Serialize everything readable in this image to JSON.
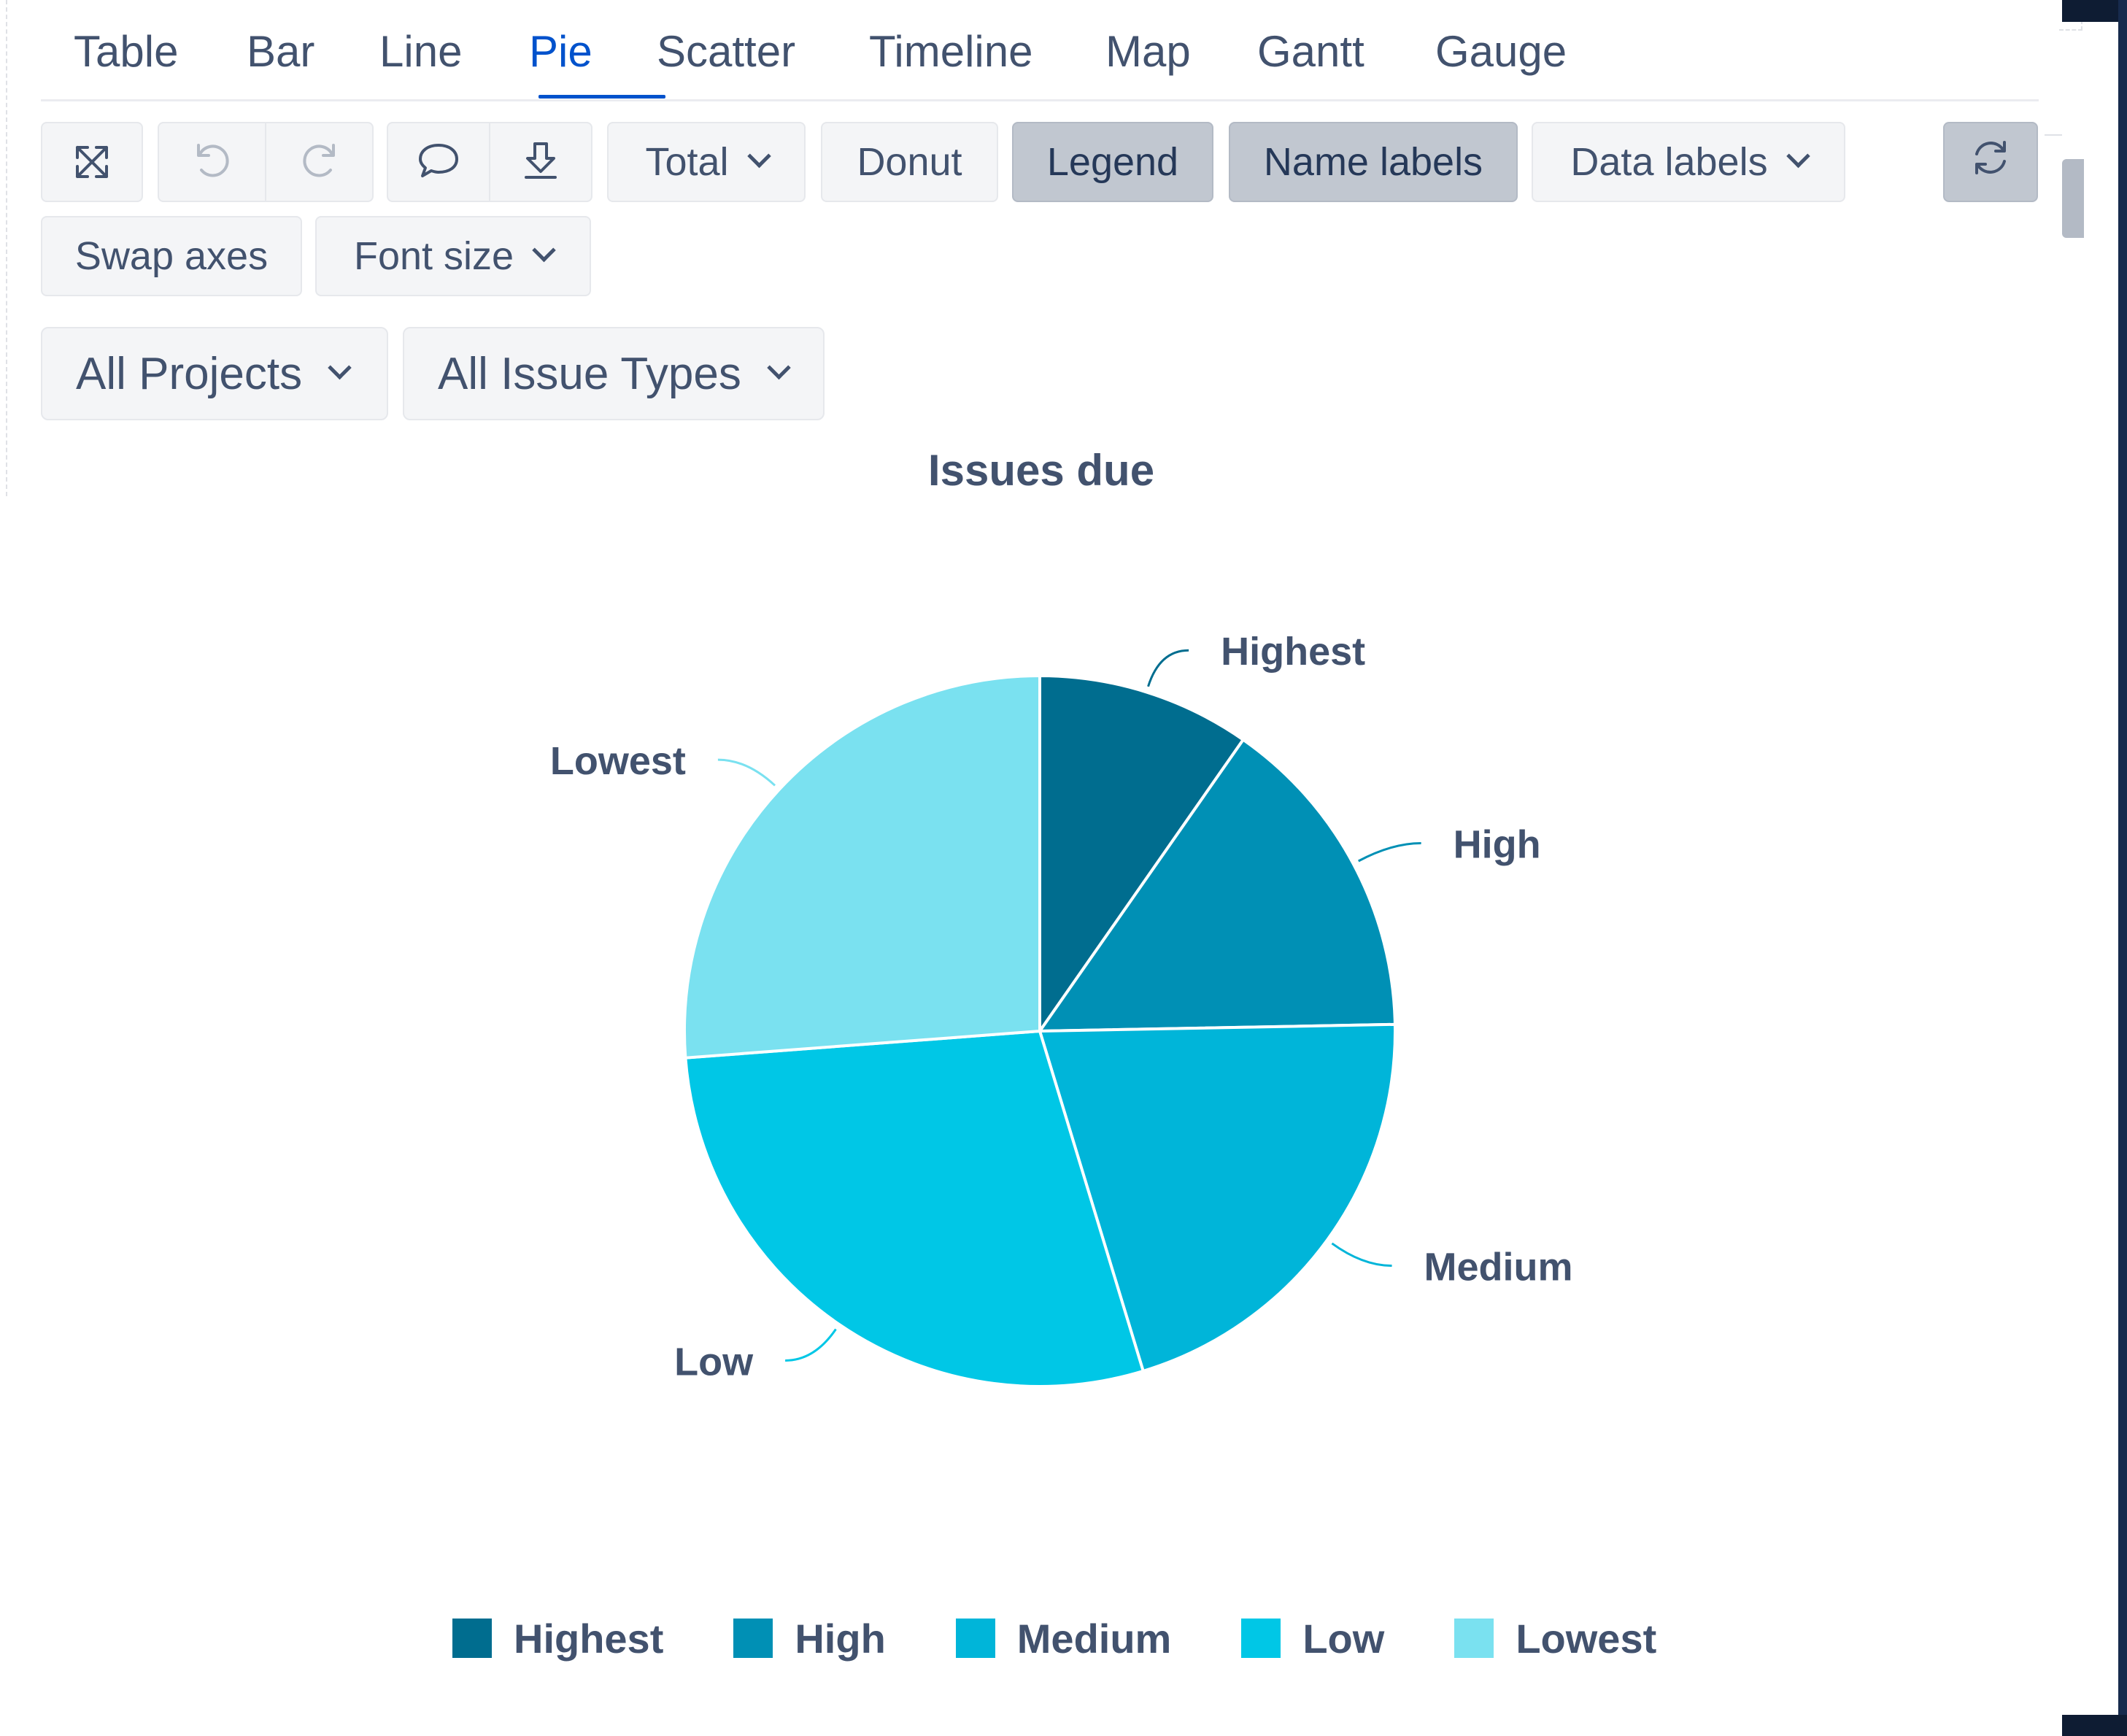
{
  "tabs": [
    "Table",
    "Bar",
    "Line",
    "Pie",
    "Scatter",
    "Timeline",
    "Map",
    "Gantt",
    "Gauge"
  ],
  "active_tab": "Pie",
  "toolbar": {
    "fullscreen_icon": "expand-arrows-icon",
    "undo_icon": "undo-icon",
    "redo_icon": "redo-icon",
    "comment_icon": "speech-bubble-icon",
    "download_icon": "download-icon",
    "total_label": "Total",
    "donut_label": "Donut",
    "legend_label": "Legend",
    "name_labels_label": "Name labels",
    "data_labels_label": "Data labels",
    "refresh_icon": "refresh-icon",
    "swap_axes_label": "Swap axes",
    "font_size_label": "Font size",
    "pressed": [
      "Legend",
      "Name labels"
    ]
  },
  "filters": {
    "projects": "All Projects",
    "issue_types": "All Issue Types"
  },
  "colors": {
    "accent": "#0052cc",
    "text": "#42526e",
    "button_bg": "#f4f5f7",
    "button_pressed_bg": "#c1c7d0"
  },
  "chart_data": {
    "type": "pie",
    "title": "Issues due",
    "categories": [
      "Highest",
      "High",
      "Medium",
      "Low",
      "Lowest"
    ],
    "values": [
      9.7,
      15.0,
      20.6,
      28.5,
      26.2
    ],
    "colors": [
      "#006d8f",
      "#0090b5",
      "#00b5d9",
      "#00c7e6",
      "#7ae1f0"
    ],
    "name_labels": true,
    "legend": "bottom"
  }
}
